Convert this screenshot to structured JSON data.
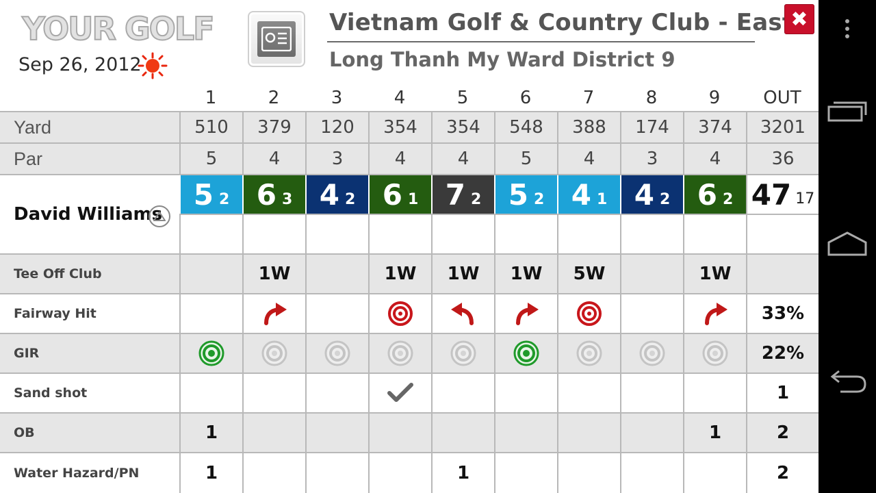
{
  "header": {
    "logo_text": "YOUR GOLF",
    "date": "Sep 26, 2012",
    "weather_icon": "sun-icon",
    "course_name": "Vietnam Golf & Country Club - East",
    "course_address": "Long Thanh My Ward District 9",
    "close_label": "✖"
  },
  "holes": [
    "1",
    "2",
    "3",
    "4",
    "5",
    "6",
    "7",
    "8",
    "9"
  ],
  "total_label": "OUT",
  "yard": {
    "label": "Yard",
    "values": [
      "510",
      "379",
      "120",
      "354",
      "354",
      "548",
      "388",
      "174",
      "374"
    ],
    "total": "3201"
  },
  "par": {
    "label": "Par",
    "values": [
      "5",
      "4",
      "3",
      "4",
      "4",
      "5",
      "4",
      "3",
      "4"
    ],
    "total": "36"
  },
  "player": {
    "name": "David Williams",
    "toggle_icon": "triangle-up-icon",
    "scores": [
      {
        "strokes": "5",
        "putts": "2",
        "color": "#1da3d8"
      },
      {
        "strokes": "6",
        "putts": "3",
        "color": "#245c10"
      },
      {
        "strokes": "4",
        "putts": "2",
        "color": "#0b3272"
      },
      {
        "strokes": "6",
        "putts": "1",
        "color": "#245c10"
      },
      {
        "strokes": "7",
        "putts": "2",
        "color": "#3a3a3a"
      },
      {
        "strokes": "5",
        "putts": "2",
        "color": "#1da3d8"
      },
      {
        "strokes": "4",
        "putts": "1",
        "color": "#1da3d8"
      },
      {
        "strokes": "4",
        "putts": "2",
        "color": "#0b3272"
      },
      {
        "strokes": "6",
        "putts": "2",
        "color": "#245c10"
      }
    ],
    "total_strokes": "47",
    "total_putts": "17"
  },
  "stats": {
    "tee_off": {
      "label": "Tee Off Club",
      "values": [
        "",
        "1W",
        "",
        "1W",
        "1W",
        "1W",
        "5W",
        "",
        "1W"
      ],
      "total": ""
    },
    "fairway": {
      "label": "Fairway Hit",
      "icons": [
        "",
        "fairway-right-icon",
        "",
        "fairway-hit-icon",
        "fairway-left-icon",
        "fairway-right-icon",
        "fairway-hit-icon",
        "",
        "fairway-right-icon"
      ],
      "total": "33%"
    },
    "gir": {
      "label": "GIR",
      "icons": [
        "gir-hit-icon",
        "gir-miss-icon",
        "gir-miss-icon",
        "gir-miss-icon",
        "gir-miss-icon",
        "gir-hit-icon",
        "gir-miss-icon",
        "gir-miss-icon",
        "gir-miss-icon"
      ],
      "total": "22%"
    },
    "sand": {
      "label": "Sand shot",
      "icons": [
        "",
        "",
        "",
        "check-icon",
        "",
        "",
        "",
        "",
        ""
      ],
      "total": "1"
    },
    "ob": {
      "label": "OB",
      "values": [
        "1",
        "",
        "",
        "",
        "",
        "",
        "",
        "",
        "1"
      ],
      "total": "2"
    },
    "water": {
      "label": "Water Hazard/PN",
      "values": [
        "1",
        "",
        "",
        "",
        "1",
        "",
        "",
        "",
        ""
      ],
      "total": "2"
    }
  },
  "navbar": {
    "menu_icon": "overflow-menu-icon",
    "recents_icon": "recent-apps-icon",
    "home_icon": "home-icon",
    "back_icon": "back-icon"
  }
}
